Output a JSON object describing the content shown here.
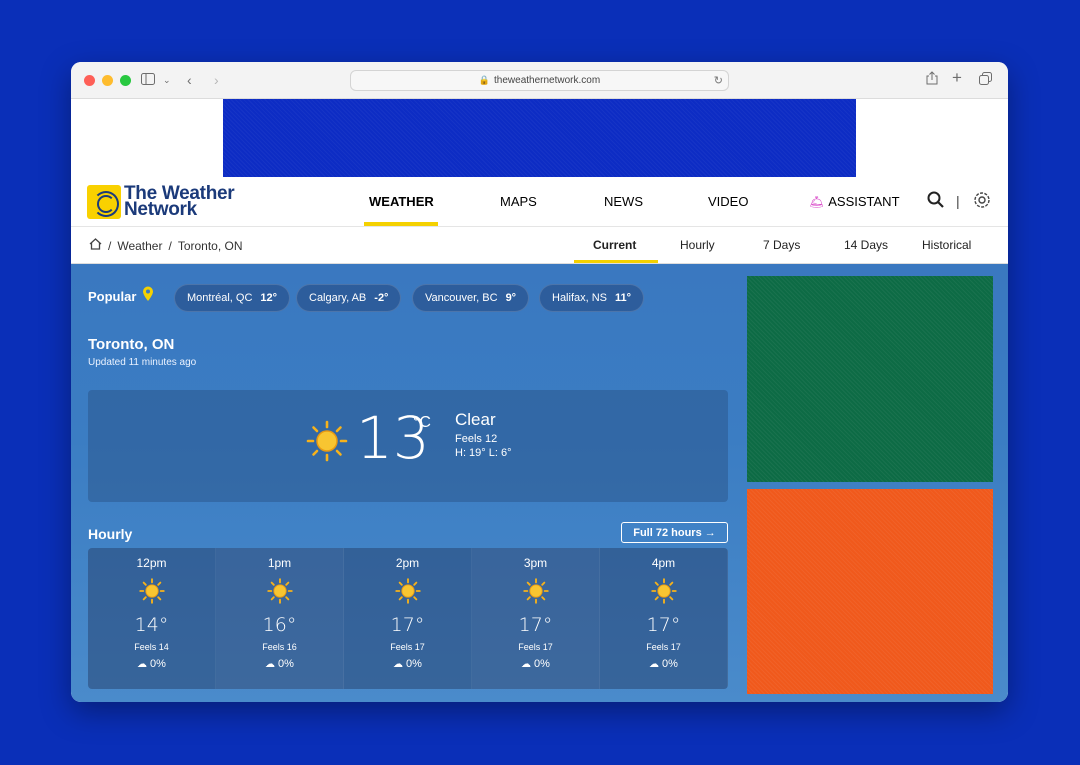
{
  "browser": {
    "url": "theweathernetwork.com"
  },
  "site": {
    "logo_line1": "The Weather",
    "logo_line2": "Network",
    "nav": [
      {
        "label": "WEATHER"
      },
      {
        "label": "MAPS"
      },
      {
        "label": "NEWS"
      },
      {
        "label": "VIDEO"
      },
      {
        "label": "ASSISTANT"
      }
    ]
  },
  "breadcrumb": [
    "Weather",
    "Toronto, ON"
  ],
  "subtabs": [
    "Current",
    "Hourly",
    "7 Days",
    "14 Days",
    "Historical"
  ],
  "popular": {
    "label": "Popular",
    "chips": [
      {
        "city": "Montréal, QC",
        "temp": "12°"
      },
      {
        "city": "Calgary, AB",
        "temp": "-2°"
      },
      {
        "city": "Vancouver, BC",
        "temp": "9°"
      },
      {
        "city": "Halifax, NS",
        "temp": "11°"
      }
    ]
  },
  "location": {
    "city": "Toronto, ON",
    "updated": "Updated 11 minutes ago"
  },
  "current": {
    "temp": "13",
    "unit": "°C",
    "condition": "Clear",
    "feels": "Feels 12",
    "high_low": "H: 19°    L: 6°"
  },
  "hourly": {
    "title": "Hourly",
    "full_label": "Full 72 hours →",
    "hours": [
      {
        "time": "12pm",
        "temp": "14°",
        "feels": "Feels 14",
        "precip": "0%"
      },
      {
        "time": "1pm",
        "temp": "16°",
        "feels": "Feels 16",
        "precip": "0%"
      },
      {
        "time": "2pm",
        "temp": "17°",
        "feels": "Feels 17",
        "precip": "0%"
      },
      {
        "time": "3pm",
        "temp": "17°",
        "feels": "Feels 17",
        "precip": "0%"
      },
      {
        "time": "4pm",
        "temp": "17°",
        "feels": "Feels 17",
        "precip": "0%"
      }
    ]
  },
  "colors": {
    "accent_yellow": "#f4d100",
    "brand_blue": "#1b3a7a",
    "ad_blue": "#0d2cc4",
    "ad_green": "#0d6b45",
    "ad_orange": "#f0591c"
  }
}
